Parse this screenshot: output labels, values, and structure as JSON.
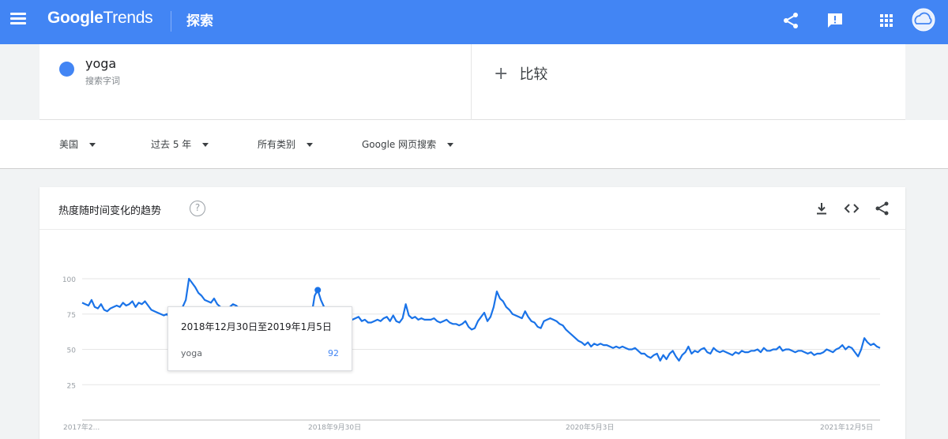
{
  "header": {
    "logo_part1": "Google",
    "logo_part2": "Trends",
    "explore": "探索",
    "icons": [
      "menu-icon",
      "share-icon",
      "feedback-icon",
      "apps-icon",
      "account-icon"
    ],
    "bg_color": "#4285f4"
  },
  "term": {
    "name": "yoga",
    "type": "搜索字词",
    "color": "#4285f4"
  },
  "compare": {
    "plus": "+",
    "label": "比较"
  },
  "filters": [
    {
      "label": "美国"
    },
    {
      "label": "过去 5 年"
    },
    {
      "label": "所有类别"
    },
    {
      "label": "Google 网页搜索"
    }
  ],
  "card": {
    "title": "热度随时间变化的趋势",
    "help": "?",
    "icons": [
      "download-icon",
      "embed-icon",
      "share-icon"
    ]
  },
  "tooltip": {
    "date": "2018年12月30日至2019年1月5日",
    "term": "yoga",
    "value": "92"
  },
  "chart_data": {
    "type": "line",
    "y_ticks": [
      "100",
      "75",
      "50",
      "25"
    ],
    "ylim": [
      0,
      100
    ],
    "x_labels": [
      "2017年2...",
      "2018年9月30日",
      "2020年5月3日",
      "2021年12月5日"
    ],
    "grid": true,
    "series": [
      {
        "name": "yoga",
        "color": "#1a73e8",
        "values": [
          83,
          82,
          81,
          85,
          80,
          79,
          82,
          78,
          77,
          79,
          80,
          81,
          80,
          83,
          81,
          82,
          84,
          80,
          83,
          82,
          84,
          81,
          78,
          77,
          76,
          75,
          74,
          75,
          72,
          73,
          74,
          76,
          80,
          85,
          100,
          97,
          94,
          90,
          88,
          85,
          84,
          83,
          86,
          82,
          80,
          79,
          78,
          80,
          82,
          81,
          79,
          78,
          77,
          78,
          79,
          76,
          74,
          75,
          78,
          74,
          73,
          71,
          72,
          74,
          75,
          73,
          70,
          72,
          74,
          75,
          76,
          73,
          72,
          74,
          88,
          92,
          85,
          80,
          79,
          76,
          74,
          73,
          75,
          72,
          73,
          70,
          71,
          72,
          73,
          70,
          71,
          69,
          69,
          70,
          71,
          70,
          72,
          73,
          70,
          74,
          70,
          69,
          72,
          82,
          74,
          72,
          73,
          71,
          72,
          71,
          71,
          71,
          72,
          70,
          69,
          70,
          71,
          69,
          68,
          68,
          67,
          68,
          70,
          66,
          64,
          65,
          70,
          73,
          76,
          70,
          73,
          80,
          91,
          86,
          84,
          80,
          78,
          75,
          74,
          73,
          72,
          77,
          73,
          70,
          69,
          66,
          65,
          70,
          71,
          72,
          71,
          70,
          68,
          67,
          64,
          62,
          60,
          58,
          56,
          55,
          53,
          55,
          52,
          54,
          53,
          54,
          53,
          53,
          52,
          51,
          52,
          51,
          52,
          51,
          50,
          50,
          51,
          49,
          47,
          47,
          45,
          44,
          46,
          47,
          42,
          46,
          43,
          47,
          49,
          45,
          42,
          46,
          48,
          52,
          47,
          49,
          48,
          50,
          51,
          48,
          47,
          51,
          49,
          48,
          49,
          48,
          47,
          46,
          48,
          47,
          49,
          48,
          48,
          49,
          49,
          50,
          48,
          51,
          49,
          49,
          50,
          50,
          52,
          49,
          50,
          50,
          49,
          48,
          49,
          49,
          48,
          47,
          48,
          46,
          47,
          47,
          48,
          50,
          49,
          48,
          50,
          51,
          53,
          50,
          52,
          51,
          48,
          45,
          50,
          58,
          55,
          53,
          54,
          52,
          51
        ]
      }
    ]
  }
}
